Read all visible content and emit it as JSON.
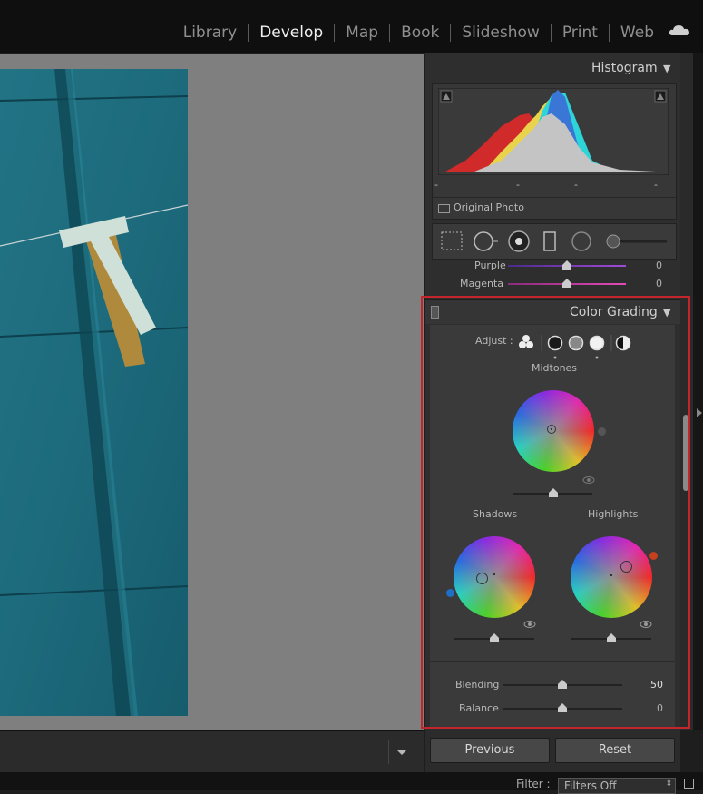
{
  "nav": {
    "modules": [
      "Library",
      "Develop",
      "Map",
      "Book",
      "Slideshow",
      "Print",
      "Web"
    ],
    "active": "Develop"
  },
  "histogram": {
    "title": "Histogram",
    "original_photo_label": "Original Photo",
    "dash_labels": [
      "-",
      "-",
      "-",
      "-"
    ]
  },
  "hsl": {
    "rows": [
      {
        "label": "Purple",
        "value": "0"
      },
      {
        "label": "Magenta",
        "value": "0"
      }
    ]
  },
  "color_grading": {
    "title": "Color Grading",
    "adjust_label": "Adjust :",
    "midtones_label": "Midtones",
    "shadows_label": "Shadows",
    "highlights_label": "Highlights",
    "blending_label": "Blending",
    "blending_value": "50",
    "balance_label": "Balance",
    "balance_value": "0"
  },
  "buttons": {
    "previous": "Previous",
    "reset": "Reset"
  },
  "filter": {
    "label": "Filter :",
    "value": "Filters Off"
  },
  "colors": {
    "accent_red": "#c4242b",
    "panel_bg": "#2e2e2e",
    "canvas_bg": "#7f7f7f"
  }
}
